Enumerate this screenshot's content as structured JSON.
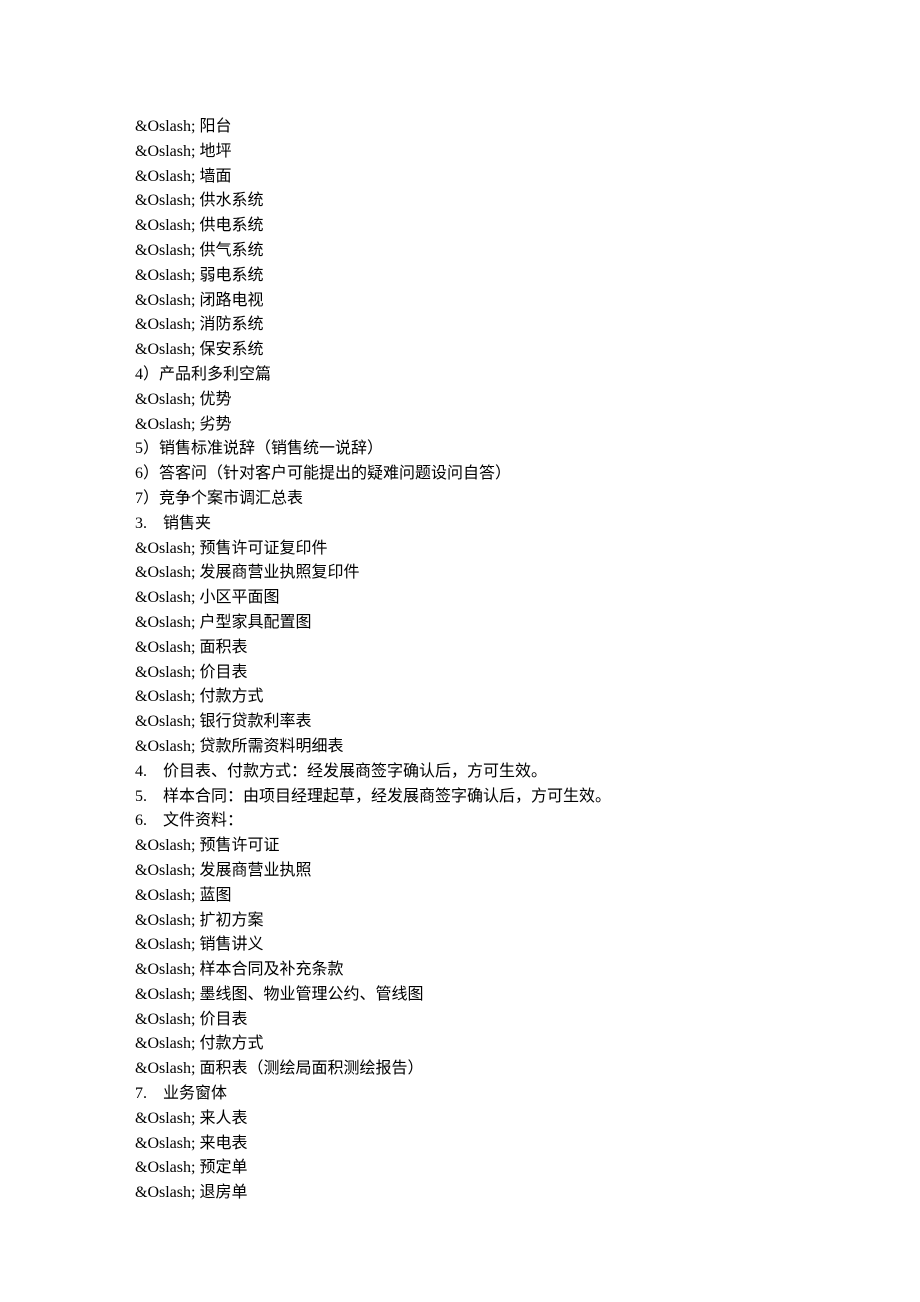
{
  "lines": [
    {
      "entity": "&Oslash;",
      "label": "阳台"
    },
    {
      "entity": "&Oslash;",
      "label": "地坪"
    },
    {
      "entity": "&Oslash;",
      "label": "墙面"
    },
    {
      "entity": "&Oslash;",
      "label": "供水系统"
    },
    {
      "entity": "&Oslash;",
      "label": "供电系统"
    },
    {
      "entity": "&Oslash;",
      "label": "供气系统"
    },
    {
      "entity": "&Oslash;",
      "label": "弱电系统"
    },
    {
      "entity": "&Oslash;",
      "label": "闭路电视"
    },
    {
      "entity": "&Oslash;",
      "label": "消防系统"
    },
    {
      "entity": "&Oslash;",
      "label": "保安系统"
    },
    {
      "text": "4）产品利多利空篇"
    },
    {
      "entity": "&Oslash;",
      "label": "优势"
    },
    {
      "entity": "&Oslash;",
      "label": "劣势"
    },
    {
      "text": "5）销售标准说辞（销售统一说辞）"
    },
    {
      "text": "6）答客问（针对客户可能提出的疑难问题设问自答）"
    },
    {
      "text": "7）竞争个案市调汇总表"
    },
    {
      "text": "3.　销售夹"
    },
    {
      "entity": "&Oslash;",
      "label": "预售许可证复印件"
    },
    {
      "entity": "&Oslash;",
      "label": "发展商营业执照复印件"
    },
    {
      "entity": "&Oslash;",
      "label": "小区平面图"
    },
    {
      "entity": "&Oslash;",
      "label": "户型家具配置图"
    },
    {
      "entity": "&Oslash;",
      "label": "面积表"
    },
    {
      "entity": "&Oslash;",
      "label": "价目表"
    },
    {
      "entity": "&Oslash;",
      "label": "付款方式"
    },
    {
      "entity": "&Oslash;",
      "label": "银行贷款利率表"
    },
    {
      "entity": "&Oslash;",
      "label": "贷款所需资料明细表"
    },
    {
      "text": "4.　价目表、付款方式：经发展商签字确认后，方可生效。"
    },
    {
      "text": "5.　样本合同：由项目经理起草，经发展商签字确认后，方可生效。"
    },
    {
      "text": "6.　文件资料："
    },
    {
      "entity": "&Oslash;",
      "label": "预售许可证"
    },
    {
      "entity": "&Oslash;",
      "label": "发展商营业执照"
    },
    {
      "entity": "&Oslash;",
      "label": "蓝图"
    },
    {
      "entity": "&Oslash;",
      "label": "扩初方案"
    },
    {
      "entity": "&Oslash;",
      "label": "销售讲义"
    },
    {
      "entity": "&Oslash;",
      "label": "样本合同及补充条款"
    },
    {
      "entity": "&Oslash;",
      "label": "墨线图、物业管理公约、管线图"
    },
    {
      "entity": "&Oslash;",
      "label": "价目表"
    },
    {
      "entity": "&Oslash;",
      "label": "付款方式"
    },
    {
      "entity": "&Oslash;",
      "label": "面积表（测绘局面积测绘报告）"
    },
    {
      "text": "7.　业务窗体"
    },
    {
      "entity": "&Oslash;",
      "label": "来人表"
    },
    {
      "entity": "&Oslash;",
      "label": "来电表"
    },
    {
      "entity": "&Oslash;",
      "label": "预定单"
    },
    {
      "entity": "&Oslash;",
      "label": "退房单"
    }
  ]
}
